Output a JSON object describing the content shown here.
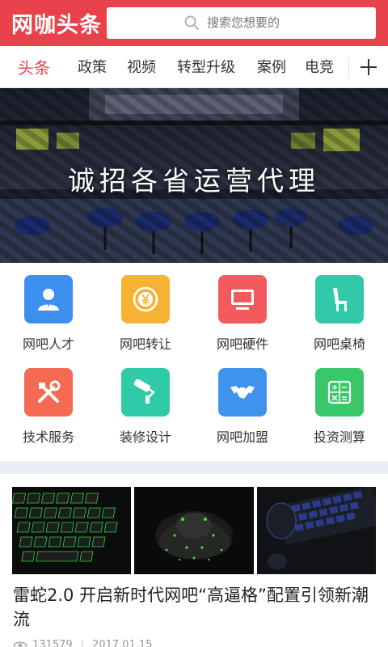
{
  "header": {
    "logo": "网咖头条",
    "search_placeholder": "搜索您想要的",
    "accent": "#e8424d"
  },
  "tabs": [
    {
      "label": "头条",
      "active": true
    },
    {
      "label": "政策"
    },
    {
      "label": "视频"
    },
    {
      "label": "转型升级"
    },
    {
      "label": "案例"
    },
    {
      "label": "电竞"
    }
  ],
  "banner": {
    "text": "诚招各省运营代理"
  },
  "grid": [
    {
      "label": "网吧人才",
      "icon": "person-icon",
      "color": "#3d8ff0"
    },
    {
      "label": "网吧转让",
      "icon": "yen-coin-icon",
      "color": "#f7b233"
    },
    {
      "label": "网吧硬件",
      "icon": "monitor-icon",
      "color": "#f25a5e"
    },
    {
      "label": "网吧桌椅",
      "icon": "chair-icon",
      "color": "#31c9a9"
    },
    {
      "label": "技术服务",
      "icon": "tools-icon",
      "color": "#f46a52"
    },
    {
      "label": "装修设计",
      "icon": "paint-roller-icon",
      "color": "#2fcaa8"
    },
    {
      "label": "网吧加盟",
      "icon": "handshake-icon",
      "color": "#3f93ec"
    },
    {
      "label": "投资测算",
      "icon": "calculator-icon",
      "color": "#3ac76a"
    }
  ],
  "article": {
    "title": "雷蛇2.0 开启新时代网吧“高逼格”配置引领新潮流",
    "views": "131579",
    "date": "2017.01.15"
  }
}
